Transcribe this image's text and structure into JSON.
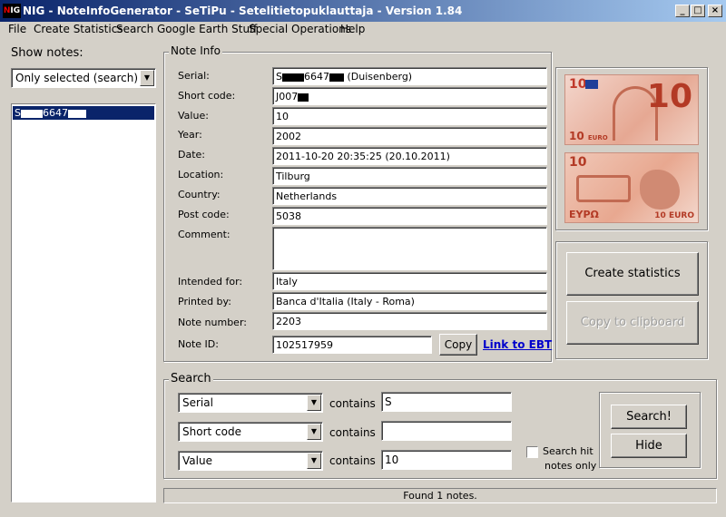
{
  "window": {
    "icon_text": "NIG",
    "title": "NIG - NoteInfoGenerator - SeTiPu - Setelitietopuklauttaja - Version 1.84"
  },
  "menu": [
    "File",
    "Create Statistics",
    "Search",
    "Google Earth Stuff",
    "Special Operations",
    "Help"
  ],
  "left": {
    "show_notes_label": "Show notes:",
    "filter_value": "Only selected (search)",
    "list_item_prefix": "S",
    "list_item_mid": "6647"
  },
  "note_info": {
    "group_title": "Note Info",
    "serial_label": "Serial:",
    "serial_prefix": "S",
    "serial_mid": "6647",
    "serial_suffix": "(Duisenberg)",
    "short_code_label": "Short code:",
    "short_code_prefix": "J007",
    "value_label": "Value:",
    "value": "10",
    "year_label": "Year:",
    "year": "2002",
    "date_label": "Date:",
    "date": "2011-10-20 20:35:25 (20.10.2011)",
    "location_label": "Location:",
    "location": "Tilburg",
    "country_label": "Country:",
    "country": "Netherlands",
    "post_code_label": "Post code:",
    "post_code": "5038",
    "comment_label": "Comment:",
    "comment": "",
    "intended_label": "Intended for:",
    "intended": "Italy",
    "printed_label": "Printed by:",
    "printed": "Banca d'Italia (Italy - Roma)",
    "note_number_label": "Note number:",
    "note_number": "2203",
    "note_id_label": "Note ID:",
    "note_id": "102517959",
    "copy_button": "Copy",
    "link_ebt": "Link to EBT"
  },
  "banknote": {
    "denomination": "10",
    "currency_word": "EURO",
    "back_currency_word": "EYPΩ"
  },
  "actions": {
    "create_statistics": "Create statistics",
    "copy_clipboard": "Copy to clipboard"
  },
  "search": {
    "group_title": "Search",
    "rows": [
      {
        "field": "Serial",
        "op": "contains",
        "value": "S"
      },
      {
        "field": "Short code",
        "op": "contains",
        "value": ""
      },
      {
        "field": "Value",
        "op": "contains",
        "value": "10"
      }
    ],
    "hit_only_label_1": "Search hit",
    "hit_only_label_2": "notes only",
    "search_button": "Search!",
    "hide_button": "Hide"
  },
  "status": "Found 1 notes.",
  "colors": {
    "title_start": "#0a246a",
    "title_end": "#a6caf0",
    "selection": "#0a246a",
    "link": "#0000cc"
  }
}
